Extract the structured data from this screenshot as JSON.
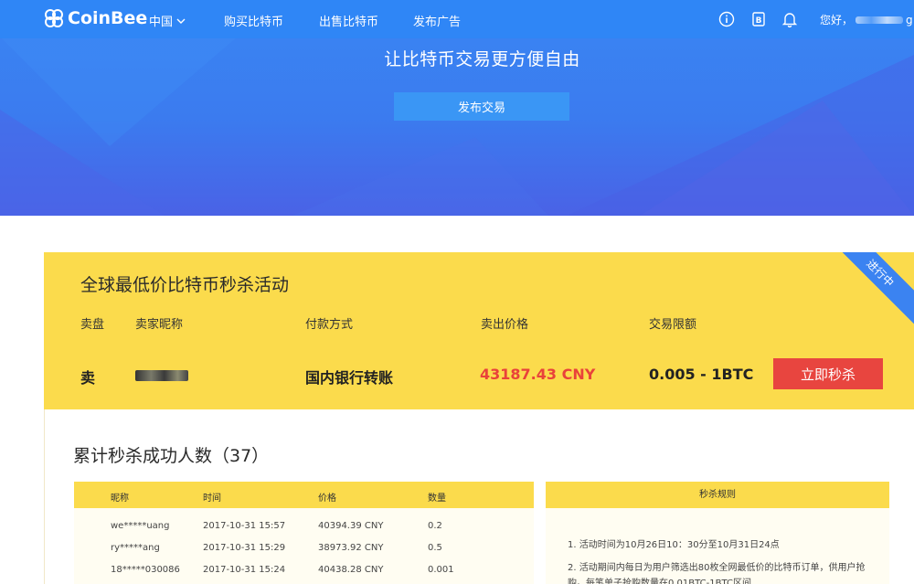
{
  "colors": {
    "nav_bg": "#2f86f6",
    "hero_top": "#3a86f3",
    "hero_bottom": "#4a62e6",
    "card_bg": "#fbdb4c",
    "accent_red": "#e8453f",
    "ribbon_blue": "#3b83f1"
  },
  "nav": {
    "logo": "CoinBee",
    "logo_icon": "coinbee-logo-icon",
    "region": "中国",
    "links": [
      "购买比特币",
      "出售比特币",
      "发布广告"
    ],
    "icons": [
      "info-icon",
      "wallet-icon",
      "bell-icon"
    ],
    "greeting": "您好，",
    "username_tail": "g"
  },
  "hero": {
    "title": "让比特币交易更方便自由",
    "button": "发布交易"
  },
  "sale": {
    "title": "全球最低价比特币秒杀活动",
    "ribbon": "进行中",
    "headers": [
      "卖盘",
      "卖家昵称",
      "付款方式",
      "卖出价格",
      "交易限额"
    ],
    "type": "卖",
    "payment": "国内银行转账",
    "price": "43187.43 CNY",
    "limit": "0.005 - 1BTC",
    "button": "立即秒杀"
  },
  "records": {
    "title": "累计秒杀成功人数（37）",
    "headers": [
      "昵称",
      "时间",
      "价格",
      "数量"
    ],
    "rows": [
      {
        "name": "we*****uang",
        "time": "2017-10-31 15:57",
        "price": "40394.39 CNY",
        "qty": "0.2"
      },
      {
        "name": "ry*****ang",
        "time": "2017-10-31 15:29",
        "price": "38973.92 CNY",
        "qty": "0.5"
      },
      {
        "name": "18*****030086",
        "time": "2017-10-31 15:24",
        "price": "40438.28 CNY",
        "qty": "0.001"
      }
    ]
  },
  "rules": {
    "title": "秒杀规则",
    "items": [
      "1. 活动时间为10月26日10：30分至10月31日24点",
      "2. 活动期间内每日为用户筛选出80枚全网最低价的比特币订单，供用户抢",
      "购。每笔单子抢购数量在0.01BTC-1BTC区间"
    ]
  }
}
